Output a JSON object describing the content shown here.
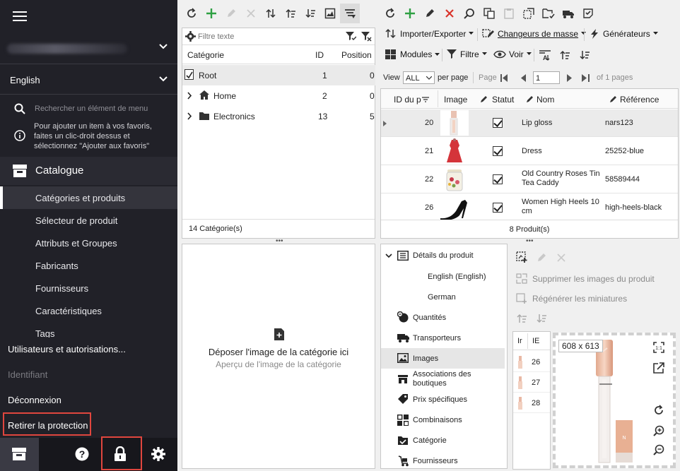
{
  "sidebar": {
    "language": "English",
    "search_placeholder": "Rechercher un élément de menu",
    "favorites_hint": [
      "Pour ajouter un item à vos favoris,",
      "faites un clic-droit dessus et",
      "sélectionnez \"Ajouter aux favoris\""
    ],
    "catalog_title": "Catalogue",
    "items": [
      {
        "label": "Catégories et produits",
        "active": true
      },
      {
        "label": "Sélecteur de produit"
      },
      {
        "label": "Attributs et Groupes"
      },
      {
        "label": "Fabricants"
      },
      {
        "label": "Fournisseurs"
      },
      {
        "label": "Caractéristiques"
      },
      {
        "label": "Tags"
      }
    ],
    "users": "Utilisateurs et autorisations...",
    "identifiant": "Identifiant",
    "logout": "Déconnexion",
    "remove_protection": "Retirer la protection"
  },
  "categories": {
    "filter_placeholder": "Filtre texte",
    "headers": {
      "category": "Catégorie",
      "id": "ID",
      "position": "Position"
    },
    "rows": [
      {
        "name": "Root",
        "id": "1",
        "position": "0"
      },
      {
        "name": "Home",
        "id": "2",
        "position": "0"
      },
      {
        "name": "Electronics",
        "id": "13",
        "position": "5"
      }
    ],
    "footer": "14 Catégorie(s)"
  },
  "dropzone": {
    "title": "Déposer l'image de la catégorie ici",
    "subtitle": "Aperçu de l'image de la catégorie"
  },
  "products": {
    "menus": {
      "import_export": "Importer/Exporter",
      "mass_changers": "Changeurs de masse",
      "generators": "Générateurs",
      "modules": "Modules",
      "filter": "Filtre",
      "view": "Voir"
    },
    "pager": {
      "view_label": "View",
      "view_value": "ALL",
      "per_page": "per page",
      "page_label": "Page",
      "page_value": "1",
      "of_pages": "of 1 pages"
    },
    "headers": {
      "id": "ID du p",
      "image": "Image",
      "status": "Statut",
      "name": "Nom",
      "reference": "Référence"
    },
    "rows": [
      {
        "id": "20",
        "name": "Lip gloss",
        "reference": "nars123",
        "thumb": "lipgloss"
      },
      {
        "id": "21",
        "name": "Dress",
        "reference": "25252-blue",
        "thumb": "dress"
      },
      {
        "id": "22",
        "name": "Old Country Roses Tin Tea Caddy",
        "reference": "58589444",
        "thumb": "caddy"
      },
      {
        "id": "26",
        "name": "Women High Heels 10 cm",
        "reference": "high-heels-black",
        "thumb": "heels"
      }
    ],
    "footer": "8 Produit(s)"
  },
  "details_tree": {
    "root": "Détails du produit",
    "languages": [
      "English (English)",
      "German"
    ],
    "items": [
      {
        "label": "Quantités",
        "icon": "quantities-icon"
      },
      {
        "label": "Transporteurs",
        "icon": "truck-icon"
      },
      {
        "label": "Images",
        "icon": "image-icon",
        "active": true
      },
      {
        "label": "Associations des boutiques",
        "icon": "shop-icon"
      },
      {
        "label": "Prix spécifiques",
        "icon": "price-tag-icon"
      },
      {
        "label": "Combinaisons",
        "icon": "combinations-icon"
      },
      {
        "label": "Catégorie",
        "icon": "category-check-icon"
      },
      {
        "label": "Fournisseurs",
        "icon": "supplier-icon"
      }
    ]
  },
  "images_panel": {
    "delete_images": "Supprimer les images du produit",
    "regen_thumbs": "Régénérer les miniatures",
    "headers": {
      "img": "Ir",
      "id": "IE"
    },
    "rows": [
      {
        "id": "26"
      },
      {
        "id": "27"
      },
      {
        "id": "28"
      }
    ],
    "preview_size": "608 x 613"
  },
  "colors": {
    "sidebar_bg": "#212128",
    "accent_red": "#e0463e",
    "add_green": "#2ea043",
    "delete_red": "#d9342b"
  }
}
